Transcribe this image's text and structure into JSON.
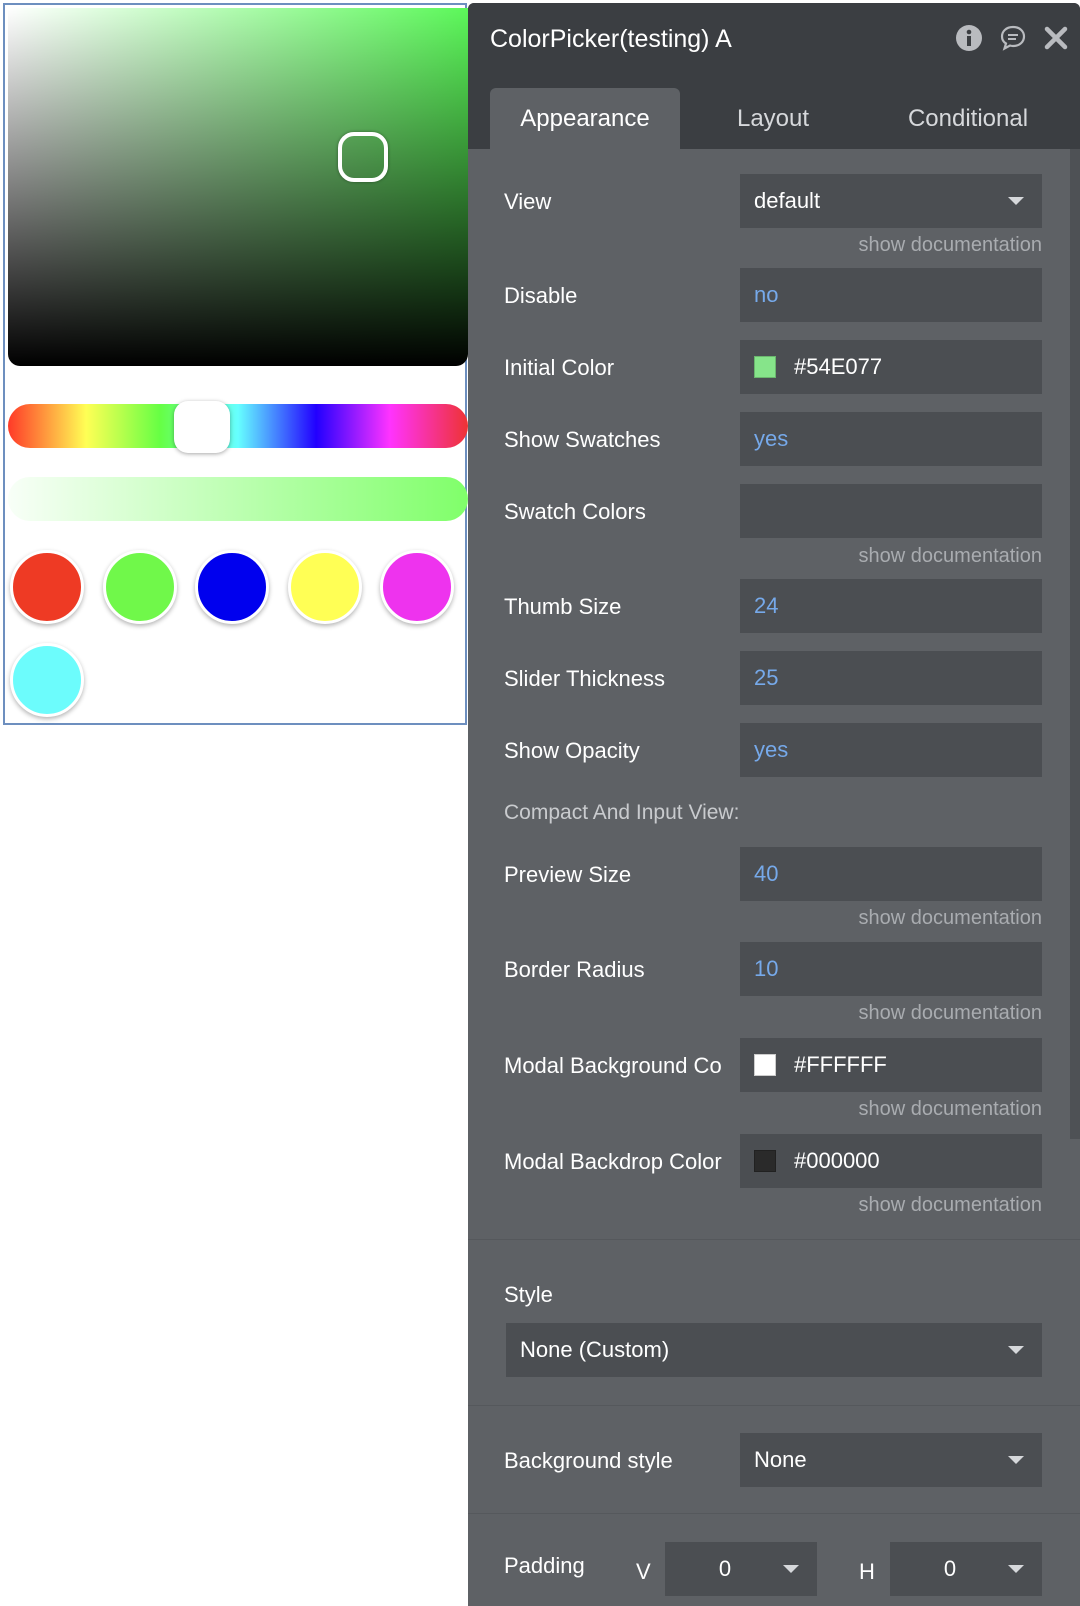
{
  "picker": {
    "hue_thumb_fraction": 0.42,
    "swatches": [
      {
        "name": "red",
        "color": "#ee3a24"
      },
      {
        "name": "green",
        "color": "#70f84a"
      },
      {
        "name": "blue",
        "color": "#0000ee"
      },
      {
        "name": "yellow",
        "color": "#ffff55"
      },
      {
        "name": "magenta",
        "color": "#ee33ee"
      },
      {
        "name": "cyan",
        "color": "#6cfcfc"
      }
    ]
  },
  "panel": {
    "title": "ColorPicker(testing) A",
    "icons": [
      "info-icon",
      "comment-icon",
      "close-icon"
    ],
    "tabs": [
      {
        "label": "Appearance",
        "active": true
      },
      {
        "label": "Layout",
        "active": false
      },
      {
        "label": "Conditional",
        "active": false
      }
    ],
    "fields": {
      "view": {
        "label": "View",
        "value": "default"
      },
      "disable": {
        "label": "Disable",
        "value": "no"
      },
      "initial_color": {
        "label": "Initial Color",
        "value": "#54E077",
        "chip": "#86e48a"
      },
      "show_swatches": {
        "label": "Show Swatches",
        "value": "yes"
      },
      "swatch_colors": {
        "label": "Swatch Colors",
        "value": ""
      },
      "thumb_size": {
        "label": "Thumb Size",
        "value": "24"
      },
      "slider_thickness": {
        "label": "Slider Thickness",
        "value": "25"
      },
      "show_opacity": {
        "label": "Show Opacity",
        "value": "yes"
      },
      "compact_section": "Compact And Input View:",
      "preview_size": {
        "label": "Preview Size",
        "value": "40"
      },
      "border_radius": {
        "label": "Border Radius",
        "value": "10"
      },
      "modal_background": {
        "label": "Modal Background Co",
        "value": "#FFFFFF",
        "chip": "#ffffff"
      },
      "modal_backdrop": {
        "label": "Modal Backdrop Color",
        "value": "#000000",
        "chip": "#2a2a2a"
      }
    },
    "doc_link": "show documentation",
    "style": {
      "label": "Style",
      "value": "None (Custom)"
    },
    "background_style": {
      "label": "Background style",
      "value": "None"
    },
    "padding": {
      "label": "Padding",
      "v_label": "V",
      "v_value": "0",
      "h_label": "H",
      "h_value": "0"
    }
  }
}
